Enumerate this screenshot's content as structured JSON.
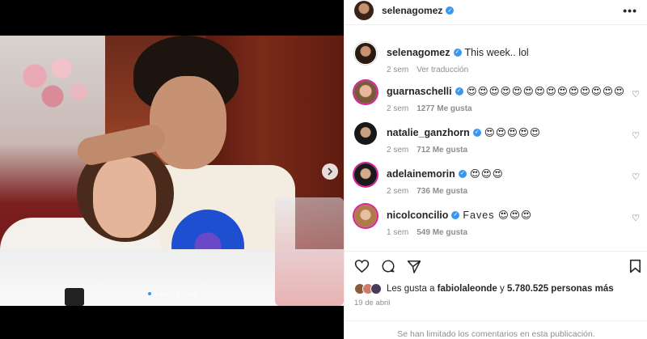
{
  "post": {
    "author": "selenagomez",
    "caption": "This week.. lol",
    "caption_age": "2 sem",
    "see_translation": "Ver traducción",
    "carousel_dots": 9,
    "carousel_active": 0
  },
  "comments": [
    {
      "username": "guarnaschelli",
      "text": "😍😍😍😍😍😍😍😍😍😍😍😍😍😍",
      "age": "2 sem",
      "likes": "1277 Me gusta"
    },
    {
      "username": "natalie_ganzhorn",
      "text": "😍😍😍😍😍",
      "age": "2 sem",
      "likes": "712 Me gusta"
    },
    {
      "username": "adelainemorin",
      "text": "😍😍😍",
      "age": "2 sem",
      "likes": "736 Me gusta"
    },
    {
      "username": "nicolconcilio",
      "text": "Faves 😍😍😍",
      "age": "1 sem",
      "likes": "549 Me gusta"
    }
  ],
  "likes": {
    "prefix": "Les gusta a",
    "user": "fabiolaleonde",
    "joiner": "y",
    "others": "5.780.525 personas más"
  },
  "date": "19 de abril",
  "comments_limited": "Se han limitado los comentarios en esta publicación.",
  "colors": {
    "accent": "#3897f0",
    "muted": "#8e8e8e",
    "text": "#262626"
  },
  "icons": [
    "more-icon",
    "verified-icon",
    "heart-icon",
    "comment-icon",
    "share-icon",
    "bookmark-icon",
    "chevron-right-icon"
  ]
}
